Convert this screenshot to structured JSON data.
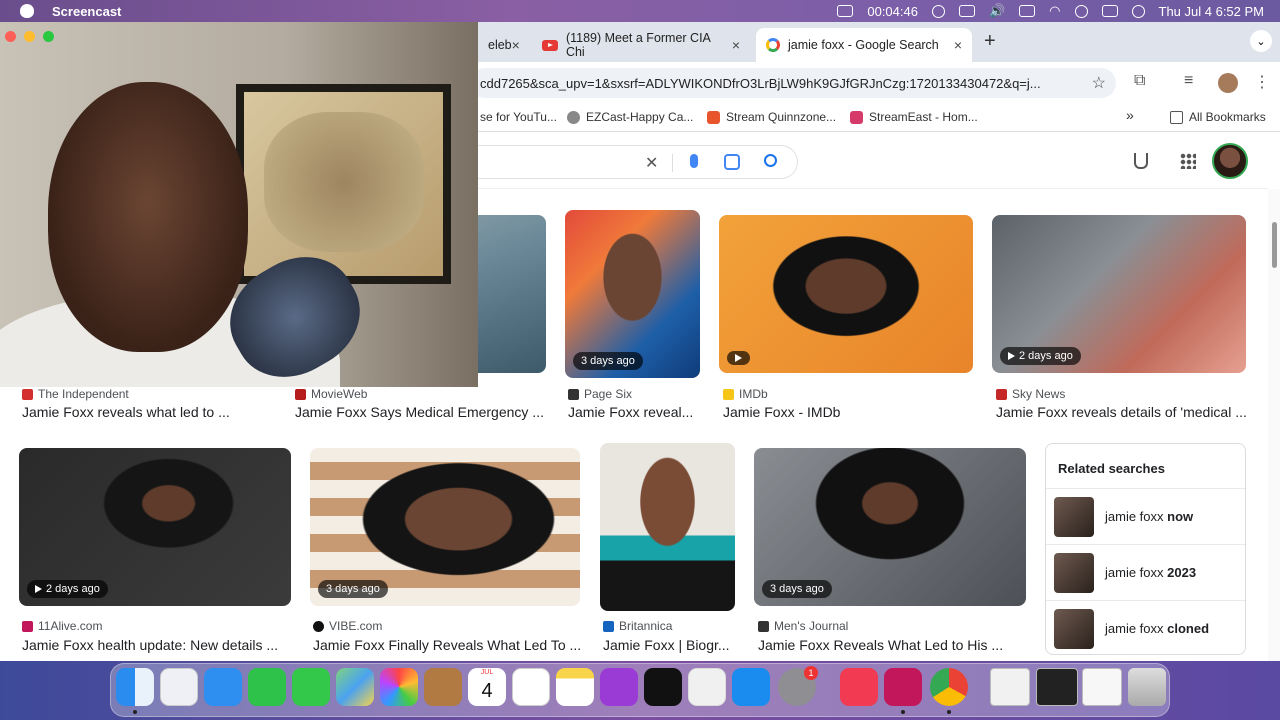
{
  "menubar": {
    "app_name": "Screencast",
    "timer": "00:04:46",
    "datetime": "Thu Jul 4  6:52 PM"
  },
  "tabs": [
    {
      "label": "eleb",
      "close": "×"
    },
    {
      "label": "(1189) Meet a Former CIA Chi",
      "close": "×"
    },
    {
      "label": "jamie foxx - Google Search",
      "close": "×"
    }
  ],
  "toolbar": {
    "new_tab": "+",
    "tab_menu": "⌄",
    "url": "cdd7265&sca_upv=1&sxsrf=ADLYWIKONDfrO3LrBjLW9hK9GJfGRJnCzg:1720133430472&q=j...",
    "star": "☆"
  },
  "bookmarks": [
    {
      "label": "se for YouTu..."
    },
    {
      "label": "EZCast-Happy Ca..."
    },
    {
      "label": "Stream Quinnzone..."
    },
    {
      "label": "StreamEast - Hom..."
    }
  ],
  "bookmarks_more": "»",
  "all_bookmarks": "All Bookmarks",
  "search": {
    "clear": "✕"
  },
  "row1": [
    {
      "source": "The Independent",
      "title": "Jamie Foxx reveals what led to ...",
      "badge": "",
      "fav": "#d32f2f",
      "img": "linear-gradient(160deg,#c7cfc4,#6d8a9a 60%,#3d5a6a)"
    },
    {
      "source": "MovieWeb",
      "title": "Jamie Foxx Says Medical Emergency ...",
      "badge": "",
      "fav": "#b71c1c",
      "img": "linear-gradient(160deg,#9aa3a6,#4a5257)"
    },
    {
      "source": "Page Six",
      "title": "Jamie Foxx reveal...",
      "badge": "3 days ago",
      "fav": "#333333",
      "img": "radial-gradient(ellipse at 50% 40%,#6b4533 0 30%,transparent 31%),linear-gradient(135deg,#e24a3b,#f07a3a 30%,#1e5fa8 70%,#0f3b7a)"
    },
    {
      "source": "IMDb",
      "title": "Jamie Foxx - IMDb",
      "badge": "",
      "fav": "#f5c518",
      "img": "radial-gradient(ellipse at 50% 45%,#5e3b2b 0 22%,#111 23% 40%,transparent 41%),linear-gradient(135deg,#f2a23a,#e8842a)"
    },
    {
      "source": "Sky News",
      "title": "Jamie Foxx reveals details of 'medical ...",
      "badge": "2 days ago",
      "fav": "#c62828",
      "img": "linear-gradient(135deg,#5b6168,#8a8f94 40%,#c06a5a 70%,#e6a090)"
    }
  ],
  "row2": [
    {
      "source": "11Alive.com",
      "title": "Jamie Foxx health update: New details ...",
      "badge": "2 days ago",
      "fav": "#c2185b",
      "img": "radial-gradient(ellipse at 55% 35%,#5e3b2b 0 12%,#151515 13% 30%,transparent 31%),linear-gradient(135deg,#2a2a2a,#3b3b3b)"
    },
    {
      "source": "VIBE.com",
      "title": "Jamie Foxx Finally Reveals What Led To ...",
      "badge": "3 days ago",
      "fav": "#111111",
      "img": "radial-gradient(ellipse at 55% 45%,#6b4533 0 25%,#141414 26% 45%,transparent 46%),repeating-linear-gradient(0deg,#f3ede4 0 18px,#c79a74 18px 36px)"
    },
    {
      "source": "Britannica",
      "title": "Jamie Foxx | Biogr...",
      "badge": "",
      "fav": "#1565c0",
      "img": "radial-gradient(ellipse at 50% 35%,#7a4b35 0 28%,transparent 29%),linear-gradient(180deg,#e9e5df 0 55%,#17a3a8 55% 70%,#151515 70%)"
    },
    {
      "source": "Men's Journal",
      "title": "Jamie Foxx Reveals What Led to His ...",
      "badge": "3 days ago",
      "fav": "#333333",
      "img": "radial-gradient(ellipse at 50% 35%,#5e3b2b 0 14%,#111 15% 38%,transparent 39%),linear-gradient(135deg,#8a8d92,#4d5156)"
    }
  ],
  "related": {
    "heading": "Related searches",
    "items": [
      {
        "prefix": "jamie foxx ",
        "bold": "now"
      },
      {
        "prefix": "jamie foxx ",
        "bold": "2023"
      },
      {
        "prefix": "jamie foxx ",
        "bold": "cloned"
      }
    ]
  },
  "dock": {
    "calendar_month": "JUL",
    "calendar_day": "4",
    "settings_badge": "1"
  }
}
